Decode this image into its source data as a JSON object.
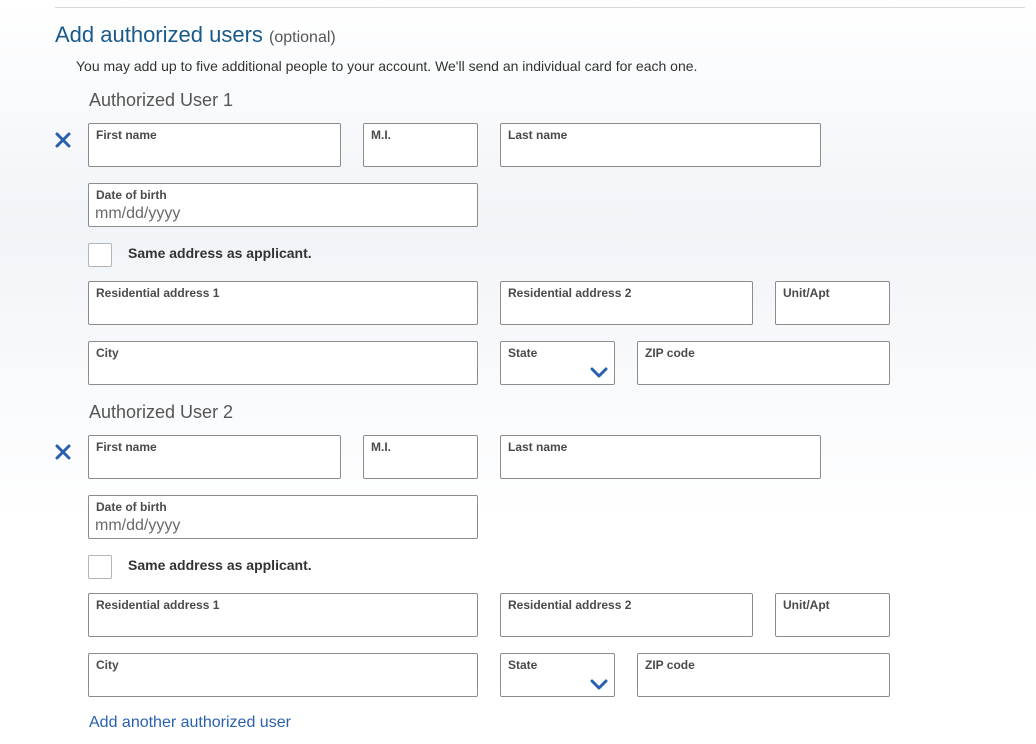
{
  "section": {
    "title": "Add authorized users",
    "optional": "(optional)",
    "intro": "You may add up to five additional people to your account. We'll send an individual card for each one."
  },
  "users": [
    {
      "heading": "Authorized User 1",
      "first_name_label": "First name",
      "mi_label": "M.I.",
      "last_name_label": "Last name",
      "dob_label": "Date of birth",
      "dob_placeholder": "mm/dd/yyyy",
      "same_address_label": "Same address as applicant.",
      "same_address_checked": false,
      "address1_label": "Residential address 1",
      "address2_label": "Residential address 2",
      "unit_label": "Unit/Apt",
      "city_label": "City",
      "state_label": "State",
      "zip_label": "ZIP code"
    },
    {
      "heading": "Authorized User 2",
      "first_name_label": "First name",
      "mi_label": "M.I.",
      "last_name_label": "Last name",
      "dob_label": "Date of birth",
      "dob_placeholder": "mm/dd/yyyy",
      "same_address_label": "Same address as applicant.",
      "same_address_checked": false,
      "address1_label": "Residential address 1",
      "address2_label": "Residential address 2",
      "unit_label": "Unit/Apt",
      "city_label": "City",
      "state_label": "State",
      "zip_label": "ZIP code"
    }
  ],
  "add_user_link": "Add another authorized user",
  "icons": {
    "remove": "close-icon",
    "dropdown": "chevron-down-icon"
  },
  "colors": {
    "heading": "#1a5a8a",
    "accent": "#2a5fb0",
    "border": "#8c8c8c"
  }
}
